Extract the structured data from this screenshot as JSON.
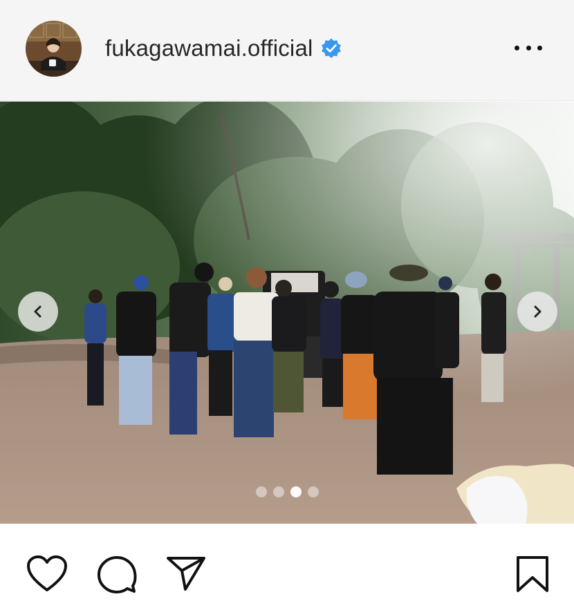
{
  "header": {
    "username": "fukagawamai.official",
    "verified": true,
    "avatar_icon": "profile-photo",
    "more_icon": "more-horizontal-icon"
  },
  "post": {
    "image_description_icon": "outdoor-film-crew-photo",
    "carousel": {
      "total_slides": 4,
      "active_slide": 3,
      "prev_icon": "chevron-left-icon",
      "next_icon": "chevron-right-icon"
    }
  },
  "actions": {
    "like_icon": "heart-icon",
    "comment_icon": "comment-icon",
    "share_icon": "send-icon",
    "save_icon": "bookmark-icon"
  },
  "colors": {
    "verified_badge": "#3897f0",
    "icon_stroke": "#111111",
    "header_bg": "#f5f5f5"
  }
}
